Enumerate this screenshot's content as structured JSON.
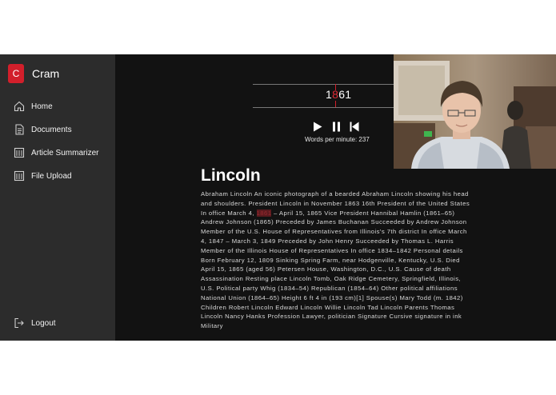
{
  "app": {
    "name": "Cram",
    "logo_letter": "C",
    "accent": "#d21f2b"
  },
  "sidebar": {
    "items": [
      {
        "label": "Home",
        "icon": "home-icon"
      },
      {
        "label": "Documents",
        "icon": "document-icon"
      },
      {
        "label": "Article Summarizer",
        "icon": "summarizer-icon"
      },
      {
        "label": "File Upload",
        "icon": "upload-icon"
      }
    ],
    "logout_label": "Logout"
  },
  "reader": {
    "word_before": "1",
    "word_pivot": "8",
    "word_after": "61",
    "wpm_label": "Words per minute: 237",
    "play_icon": "play-icon",
    "pause_icon": "pause-icon",
    "restart_icon": "skip-back-icon"
  },
  "article": {
    "title": "Lincoln",
    "text_before": "Abraham Lincoln An iconic photograph of a bearded Abraham Lincoln showing his head and shoulders. President Lincoln in November 1863 16th President of the United States In office March 4, ",
    "text_highlight": "1861",
    "text_after": " – April 15, 1865 Vice President Hannibal Hamlin (1861–65) Andrew Johnson (1865) Preceded by James Buchanan Succeeded by Andrew Johnson Member of the U.S. House of Representatives from Illinois's 7th district In office March 4, 1847 – March 3, 1849 Preceded by John Henry Succeeded by Thomas L. Harris Member of the Illinois House of Representatives In office 1834–1842 Personal details Born February 12, 1809 Sinking Spring Farm, near Hodgenville, Kentucky, U.S. Died April 15, 1865 (aged 56) Petersen House, Washington, D.C., U.S. Cause of death Assassination Resting place Lincoln Tomb, Oak Ridge Cemetery, Springfield, Illinois, U.S. Political party Whig (1834–54) Republican (1854–64) Other political affiliations National Union (1864–65) Height 6 ft 4 in (193 cm)[1] Spouse(s) Mary Todd (m. 1842) Children Robert Lincoln Edward Lincoln Willie Lincoln Tad Lincoln Parents Thomas Lincoln Nancy Hanks Profession Lawyer, politician Signature Cursive signature in ink Military"
  }
}
